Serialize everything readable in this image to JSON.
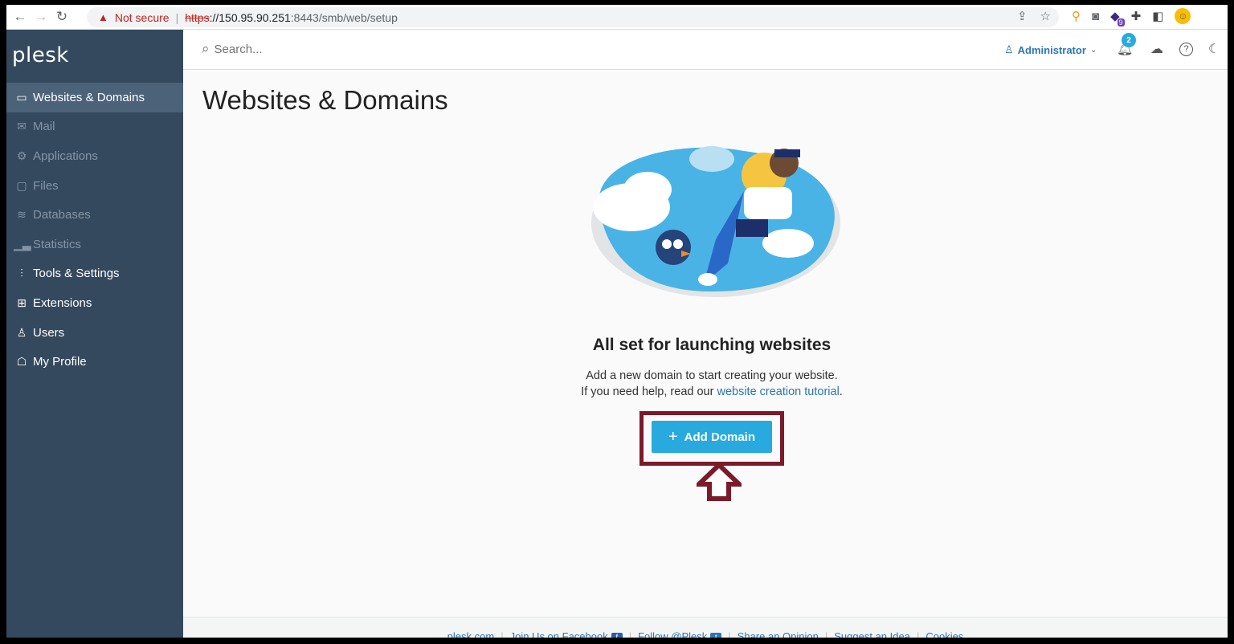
{
  "browser": {
    "not_secure": "Not secure",
    "url_scheme": "https",
    "url_host": "://150.95.90.251",
    "url_path": ":8443/smb/web/setup",
    "extension_badge": "9"
  },
  "sidebar": {
    "logo": "plesk",
    "items": [
      {
        "label": "Websites & Domains",
        "icon": "monitor-icon",
        "active": true
      },
      {
        "label": "Mail",
        "icon": "mail-icon",
        "disabled": true
      },
      {
        "label": "Applications",
        "icon": "gear-icon",
        "disabled": true
      },
      {
        "label": "Files",
        "icon": "folder-icon",
        "disabled": true
      },
      {
        "label": "Databases",
        "icon": "database-icon",
        "disabled": true
      },
      {
        "label": "Statistics",
        "icon": "bar-chart-icon",
        "disabled": true
      },
      {
        "label": "Tools & Settings",
        "icon": "sliders-icon"
      },
      {
        "label": "Extensions",
        "icon": "grid-icon"
      },
      {
        "label": "Users",
        "icon": "user-icon"
      },
      {
        "label": "My Profile",
        "icon": "profile-icon"
      }
    ]
  },
  "header": {
    "search_placeholder": "Search...",
    "user": "Administrator",
    "notifications_count": "2"
  },
  "main": {
    "title": "Websites & Domains",
    "empty_title": "All set for launching websites",
    "line1": "Add a new domain to start creating your website.",
    "line2_prefix": "If you need help, read our ",
    "line2_link": "website creation tutorial",
    "line2_suffix": ".",
    "add_domain": "Add Domain"
  },
  "footer": {
    "links": [
      "plesk.com",
      "Join Us on Facebook",
      "Follow @Plesk",
      "Share an Opinion",
      "Suggest an Idea",
      "Cookies"
    ]
  },
  "colors": {
    "sidebar_bg": "#35495e",
    "accent": "#28aade",
    "link": "#2c76b5",
    "highlight": "#7b1b2a"
  }
}
